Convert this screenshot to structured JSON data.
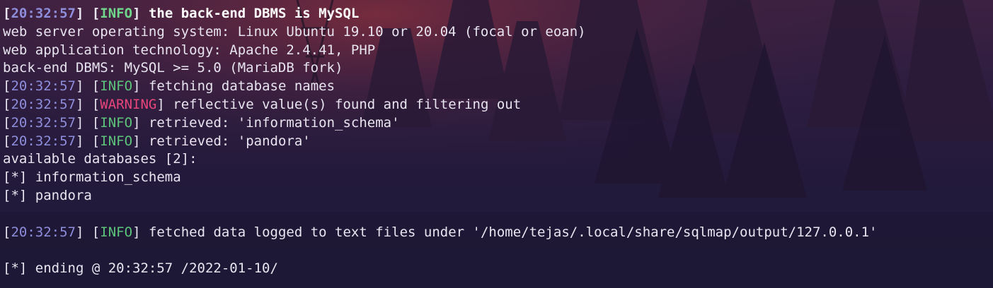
{
  "colors": {
    "background": "#231a3b",
    "timestamp": "#8e8edc",
    "info": "#5cc47a",
    "warning": "#e8457b",
    "text": "#e8e4f0"
  },
  "lines": [
    {
      "time": "20:32:57",
      "level": "INFO",
      "msg": " the back-end DBMS is MySQL"
    },
    {
      "text": "web server operating system: Linux Ubuntu 19.10 or 20.04 (focal or eoan)"
    },
    {
      "text": "web application technology: Apache 2.4.41, PHP"
    },
    {
      "text": "back-end DBMS: MySQL >= 5.0 (MariaDB fork)"
    },
    {
      "time": "20:32:57",
      "level": "INFO",
      "msg": " fetching database names"
    },
    {
      "time": "20:32:57",
      "level": "WARNING",
      "msg": " reflective value(s) found and filtering out"
    },
    {
      "time": "20:32:57",
      "level": "INFO",
      "msg": " retrieved: 'information_schema'"
    },
    {
      "time": "20:32:57",
      "level": "INFO",
      "msg": " retrieved: 'pandora'"
    },
    {
      "text": "available databases [2]:"
    },
    {
      "text": "[*] information_schema"
    },
    {
      "text": "[*] pandora"
    },
    {
      "text": ""
    },
    {
      "time": "20:32:57",
      "level": "INFO",
      "msg": " fetched data logged to text files under '/home/tejas/.local/share/sqlmap/output/127.0.0.1'"
    },
    {
      "text": ""
    },
    {
      "text": "[*] ending @ 20:32:57 /2022-01-10/"
    }
  ]
}
